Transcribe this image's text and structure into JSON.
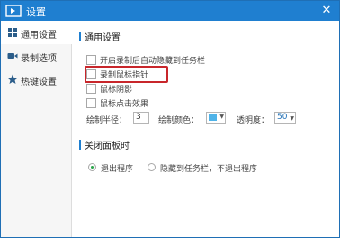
{
  "window": {
    "title": "设置",
    "close_glyph": "✕"
  },
  "sidebar": {
    "items": [
      {
        "label": "通用设置",
        "icon": "grid-icon",
        "active": true
      },
      {
        "label": "录制选项",
        "icon": "video-camera-icon",
        "active": false
      },
      {
        "label": "热键设置",
        "icon": "star-icon",
        "active": false
      }
    ]
  },
  "general": {
    "title": "通用设置",
    "options": [
      {
        "label": "开启录制后自动隐藏到任务栏",
        "checked": false
      },
      {
        "label": "录制鼠标指针",
        "checked": false,
        "highlighted": true
      },
      {
        "label": "鼠标阴影",
        "checked": false
      },
      {
        "label": "鼠标点击效果",
        "checked": false
      }
    ],
    "radius_label": "绘制半径：",
    "radius_value": "3",
    "color_label": "绘制颜色：",
    "color_value": "#4fb3e8",
    "opacity_label": "透明度：",
    "opacity_value": "50"
  },
  "close_panel": {
    "title": "关闭面板时",
    "options": [
      {
        "label": "退出程序",
        "selected": true
      },
      {
        "label": "隐藏到任务栏，不退出程序",
        "selected": false
      }
    ]
  },
  "colors": {
    "accent": "#1f7fd0",
    "highlight": "#c8262b",
    "radio_selected": "#2aa64b"
  }
}
